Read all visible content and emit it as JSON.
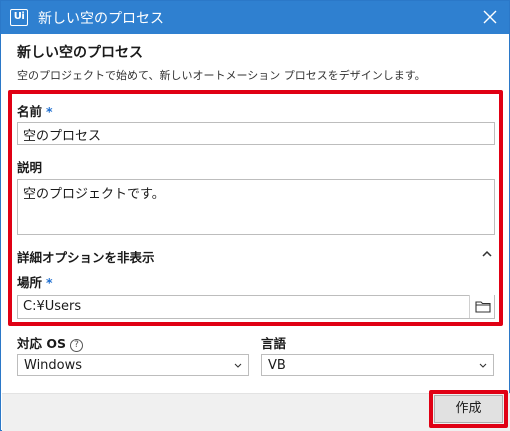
{
  "window": {
    "title": "新しい空のプロセス",
    "logo_text": "Ui"
  },
  "header": {
    "heading": "新しい空のプロセス",
    "description": "空のプロジェクトで始めて、新しいオートメーション プロセスをデザインします。"
  },
  "form": {
    "name_label": "名前",
    "required_mark": "*",
    "name_value": "空のプロセス",
    "description_label": "説明",
    "description_value": "空のプロジェクトです。",
    "advanced_toggle_label": "詳細オプションを非表示",
    "location_label": "場所",
    "location_value": "C:¥Users",
    "os_label": "対応 OS",
    "os_value": "Windows",
    "language_label": "言語",
    "language_value": "VB"
  },
  "footer": {
    "create_label": "作成"
  },
  "colors": {
    "titlebar": "#2f80d0",
    "highlight": "#e00014",
    "required": "#1f6fd0"
  },
  "icons": [
    "app-logo-icon",
    "close-icon",
    "chevron-up-icon",
    "folder-icon",
    "help-icon",
    "chevron-down-icon"
  ]
}
